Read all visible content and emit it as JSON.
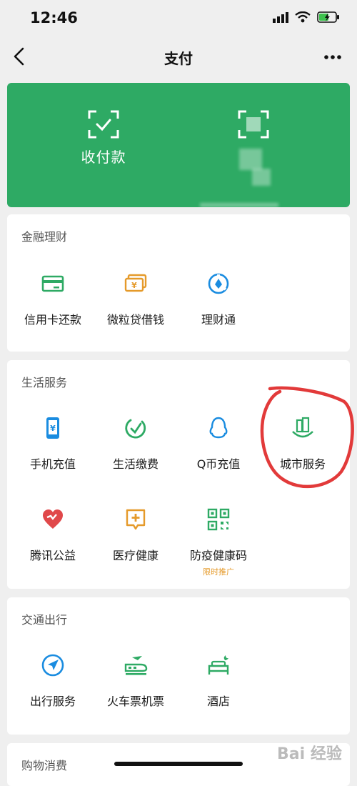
{
  "status_bar": {
    "time": "12:46"
  },
  "nav": {
    "title": "支付"
  },
  "banner": {
    "receive_label": "收付款",
    "wallet_label": ""
  },
  "sections": [
    {
      "title": "金融理财",
      "items": [
        {
          "label": "信用卡还款",
          "icon": "credit-card-icon"
        },
        {
          "label": "微粒贷借钱",
          "icon": "loan-icon"
        },
        {
          "label": "理财通",
          "icon": "wealth-icon"
        }
      ]
    },
    {
      "title": "生活服务",
      "items": [
        {
          "label": "手机充值",
          "icon": "phone-recharge-icon"
        },
        {
          "label": "生活缴费",
          "icon": "utility-icon"
        },
        {
          "label": "Q币充值",
          "icon": "qq-icon"
        },
        {
          "label": "城市服务",
          "icon": "city-icon"
        },
        {
          "label": "腾讯公益",
          "icon": "charity-icon"
        },
        {
          "label": "医疗健康",
          "icon": "medical-icon"
        },
        {
          "label": "防疫健康码",
          "icon": "qr-code-icon",
          "badge": "限时推广"
        }
      ]
    },
    {
      "title": "交通出行",
      "items": [
        {
          "label": "出行服务",
          "icon": "travel-icon"
        },
        {
          "label": "火车票机票",
          "icon": "train-icon"
        },
        {
          "label": "酒店",
          "icon": "hotel-icon"
        }
      ]
    },
    {
      "title": "购物消费",
      "items": []
    }
  ],
  "watermark": {
    "text": "Bai 经验"
  },
  "colors": {
    "green": "#2eaa64",
    "blue": "#1a8ce0",
    "orange": "#e59a2a",
    "red": "#e0484a",
    "annotation": "#e23a3a"
  }
}
